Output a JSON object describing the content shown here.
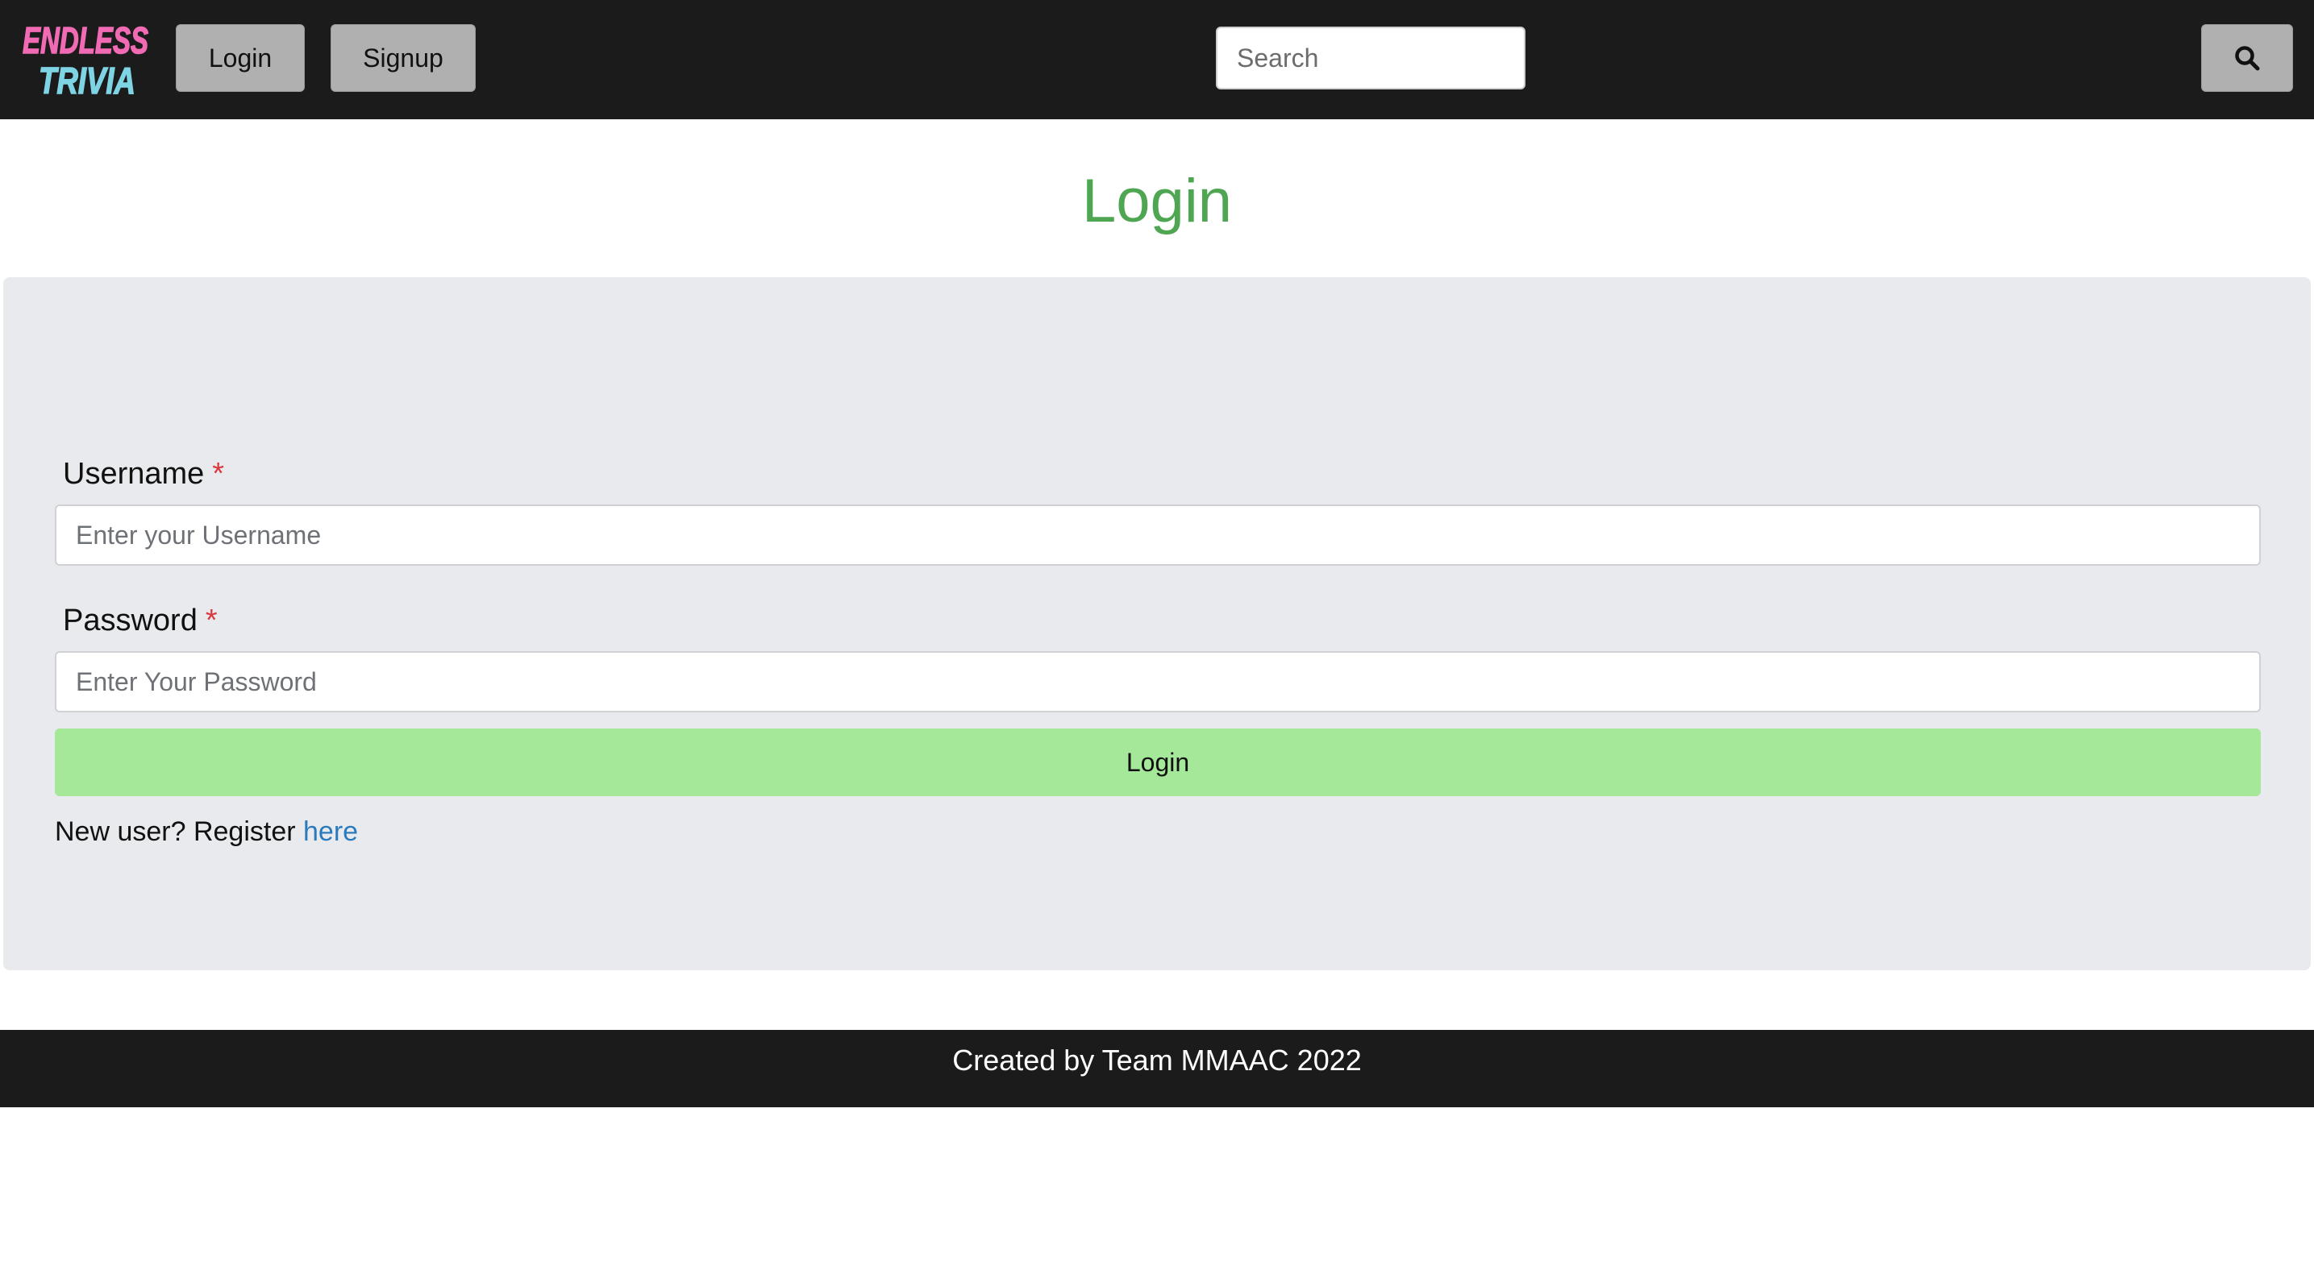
{
  "header": {
    "logo": {
      "line1": "ENDLESS",
      "line2": "TRIVIA",
      "color_top": "#f06ab4",
      "color_bottom": "#7fd4e4"
    },
    "login_label": "Login",
    "signup_label": "Signup",
    "search_placeholder": "Search",
    "search_button_icon": "search-icon"
  },
  "main": {
    "title": "Login",
    "username": {
      "label": "Username",
      "required_mark": "*",
      "placeholder": "Enter your Username"
    },
    "password": {
      "label": "Password",
      "required_mark": "*",
      "placeholder": "Enter Your Password"
    },
    "submit_label": "Login",
    "register_prefix": "New user? Register",
    "register_link": "here"
  },
  "footer": {
    "text": "Created by Team MMAAC 2022"
  },
  "colors": {
    "nav_background": "#1b1b1b",
    "title": "#4ea652",
    "panel": "#e9eaed",
    "submit_button": "#a6e89a",
    "required": "#d9383f",
    "link": "#2a7bbd"
  }
}
